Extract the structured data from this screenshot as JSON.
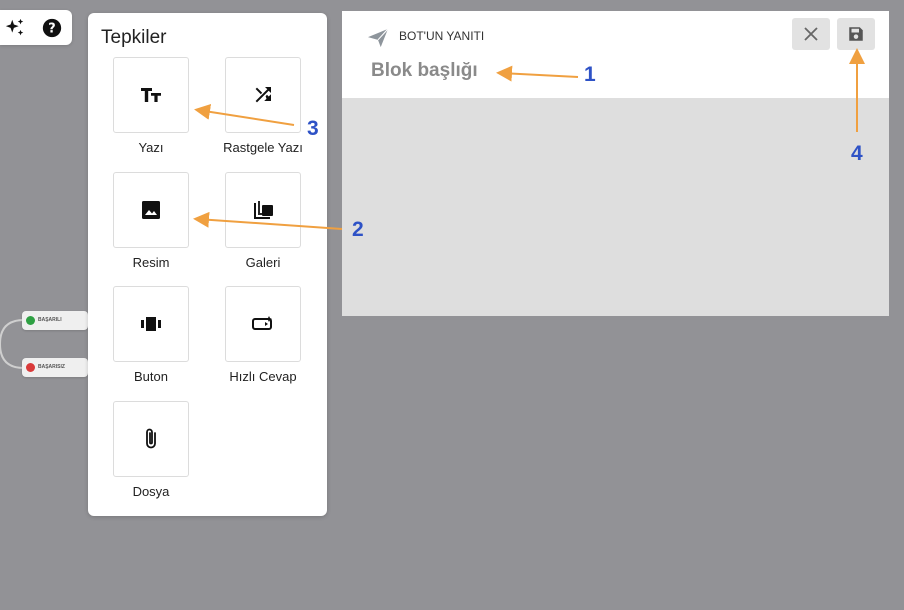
{
  "colors": {
    "canvas": "#929296",
    "annotation_arrow": "#f0a040",
    "annotation_number": "#2e52c6",
    "success": "#2ea043",
    "error": "#d93a3a"
  },
  "toolbar": {
    "icons": [
      "sparkles-icon",
      "help-icon"
    ]
  },
  "flow_nodes": [
    {
      "label": "BAŞARILI",
      "status": "success"
    },
    {
      "label": "BAŞARISIZ",
      "status": "error"
    }
  ],
  "reactions_panel": {
    "title": "Tepkiler",
    "items": [
      {
        "label": "Yazı",
        "icon": "text-icon"
      },
      {
        "label": "Rastgele Yazı",
        "icon": "shuffle-icon"
      },
      {
        "label": "Resim",
        "icon": "image-icon"
      },
      {
        "label": "Galeri",
        "icon": "gallery-icon"
      },
      {
        "label": "Buton",
        "icon": "button-icon"
      },
      {
        "label": "Hızlı Cevap",
        "icon": "quick-reply-icon"
      },
      {
        "label": "Dosya",
        "icon": "attachment-icon"
      }
    ]
  },
  "editor": {
    "kind_label": "BOT'UN YANITI",
    "title_placeholder": "Blok başlığı",
    "buttons": [
      "close-icon",
      "save-icon"
    ]
  },
  "annotations": [
    "1",
    "2",
    "3",
    "4"
  ]
}
